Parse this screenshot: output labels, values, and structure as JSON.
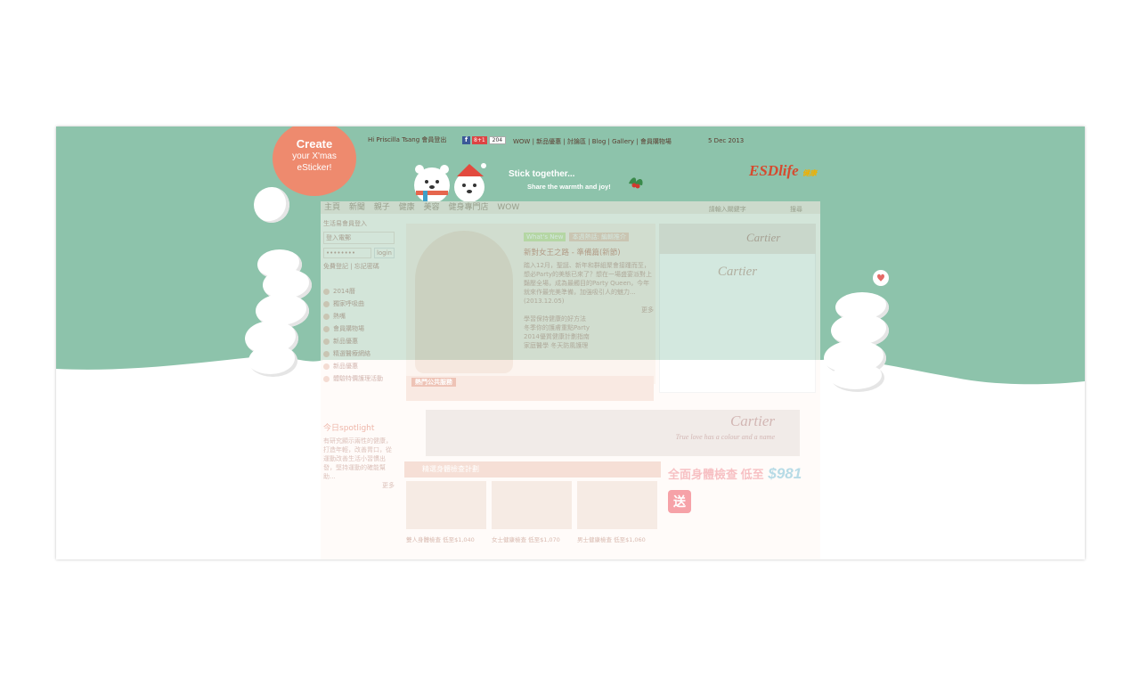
{
  "colors": {
    "mint": "#8dc3ab",
    "snow": "#ffffff",
    "badge": "#ee8a6e",
    "brand": "#d64a2e"
  },
  "topbar": {
    "greeting": "Hi Priscilla Tsang 會員登出",
    "social": {
      "fb": "f",
      "gplus": "8+1",
      "count": "204"
    },
    "links": [
      "WOW",
      "新品優惠",
      "討論區",
      "Blog",
      "Gallery",
      "會員購物場"
    ],
    "date": "5 Dec 2013"
  },
  "create_badge": {
    "line1": "Create",
    "line2": "your X'mas",
    "line3": "eSticker!"
  },
  "tagline": {
    "line1": "Stick together...",
    "line2": "Share the warmth and joy!"
  },
  "logo": {
    "main": "ESDlife",
    "accent": "健康"
  },
  "site": {
    "nav": [
      "主頁",
      "新聞",
      "親子",
      "健康",
      "美容",
      "健身專門店",
      "WOW"
    ],
    "search_placeholder": "請輸入關鍵字",
    "search_button": "搜尋",
    "login_title": "生活易會員登入",
    "login_user_placeholder": "登入電郵",
    "login_pass": "••••••••",
    "login_button": "login",
    "login_links": "免費登記 | 忘記密碼",
    "sidebar": [
      "2014曆",
      "獨家呼吸曲",
      "熱嘴",
      "會員購物場",
      "新品優惠",
      "精選醫療網絡",
      "新品優惠",
      "體驗特價護理活動"
    ],
    "feature": {
      "tag": "What's New",
      "heading": "本週熱話: 編輯推介",
      "title": "新對女王之路 - 準備篇(新節)",
      "body": "踏入12月，聖誕、新年和群組聚會接踵而至，想必Party的美態已來了？想在一場盛宴派對上豔壓全場，成為最觸目的Party Queen，今年就來作最完美準備，加強吸引人的魅力...",
      "date": "(2013.12.05)",
      "more": "更多",
      "items": [
        "學習保持健康的好方法",
        "冬季你的護膚重點Party",
        "2014優質健康計劃指南",
        "家庭醫學 冬天防風護理"
      ]
    },
    "hot_label": "熱門公共服務",
    "ad_top": "Cartier",
    "ad_right": "Cartier",
    "banner": {
      "title": "Cartier",
      "sub": "True love has a colour and a name"
    },
    "plan_title": "精選身體檢查計劃",
    "plans": [
      {
        "caption": "雙人身體檢查 低至$1,040"
      },
      {
        "caption": "女士健康檢查 低至$1,070"
      },
      {
        "caption": "男士健康檢查 低至$1,060"
      }
    ],
    "ad2": {
      "title": "全面身體檢查 低至",
      "price": "$981",
      "badge": "送"
    },
    "spotlight": {
      "title": "今日spotlight",
      "body": "有研究顯示兩性的健康，打造年輕，改善胃口，從運動改善生活小習慣出發，堅持運動的確能幫助...",
      "more": "更多"
    }
  }
}
